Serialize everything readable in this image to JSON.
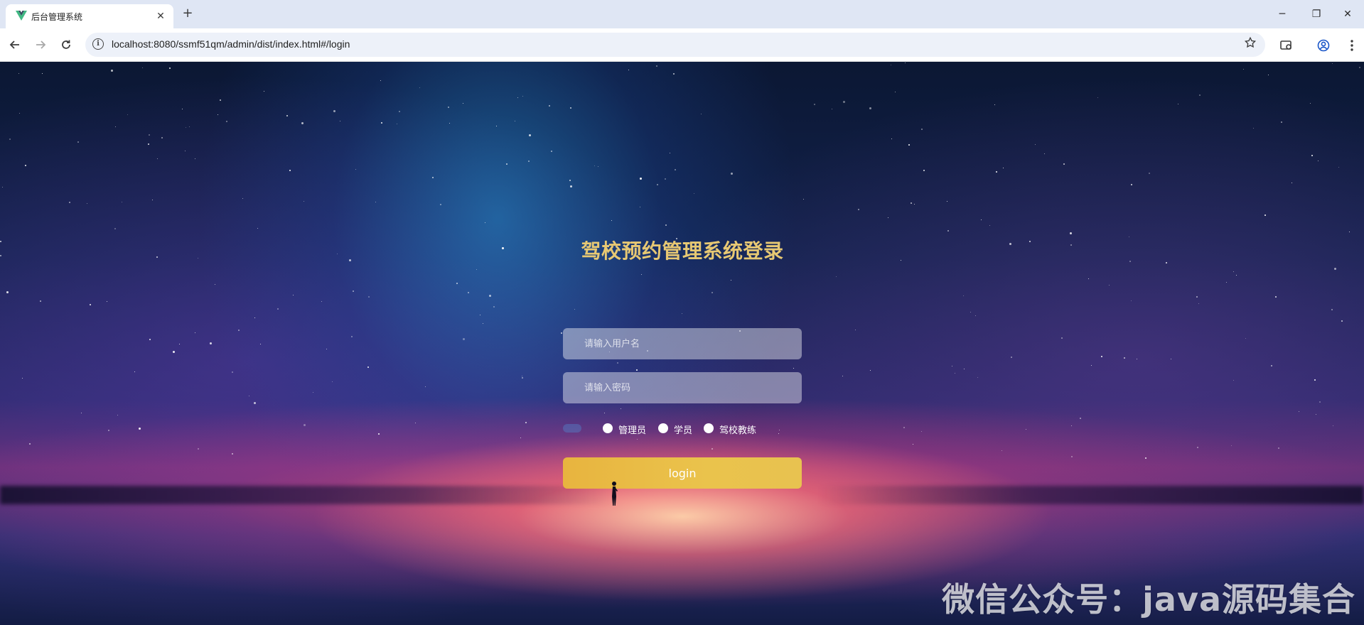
{
  "browser": {
    "tab_title": "后台管理系统",
    "tab_close": "✕",
    "new_tab": "+",
    "url": "localhost:8080/ssmf51qm/admin/dist/index.html#/login",
    "window": {
      "minimize": "─",
      "restore": "❐",
      "close": "✕"
    }
  },
  "login": {
    "title": "驾校预约管理系统登录",
    "username_placeholder": "请输入用户名",
    "password_placeholder": "请输入密码",
    "roles": [
      "管理员",
      "学员",
      "驾校教练"
    ],
    "button_label": "login"
  },
  "watermark": "微信公众号：java源码集合",
  "colors": {
    "title": "#e7c873",
    "button": "#e8b43f",
    "tabbar": "#dfe6f4"
  },
  "icons": {
    "favicon": "vue-logo-icon",
    "back": "arrow-left-icon",
    "forward": "arrow-right-icon",
    "reload": "reload-icon",
    "site_info": "info-icon",
    "bookmark": "star-icon",
    "tab_search": "tab-search-icon",
    "profile": "profile-icon",
    "menu": "more-vertical-icon"
  }
}
